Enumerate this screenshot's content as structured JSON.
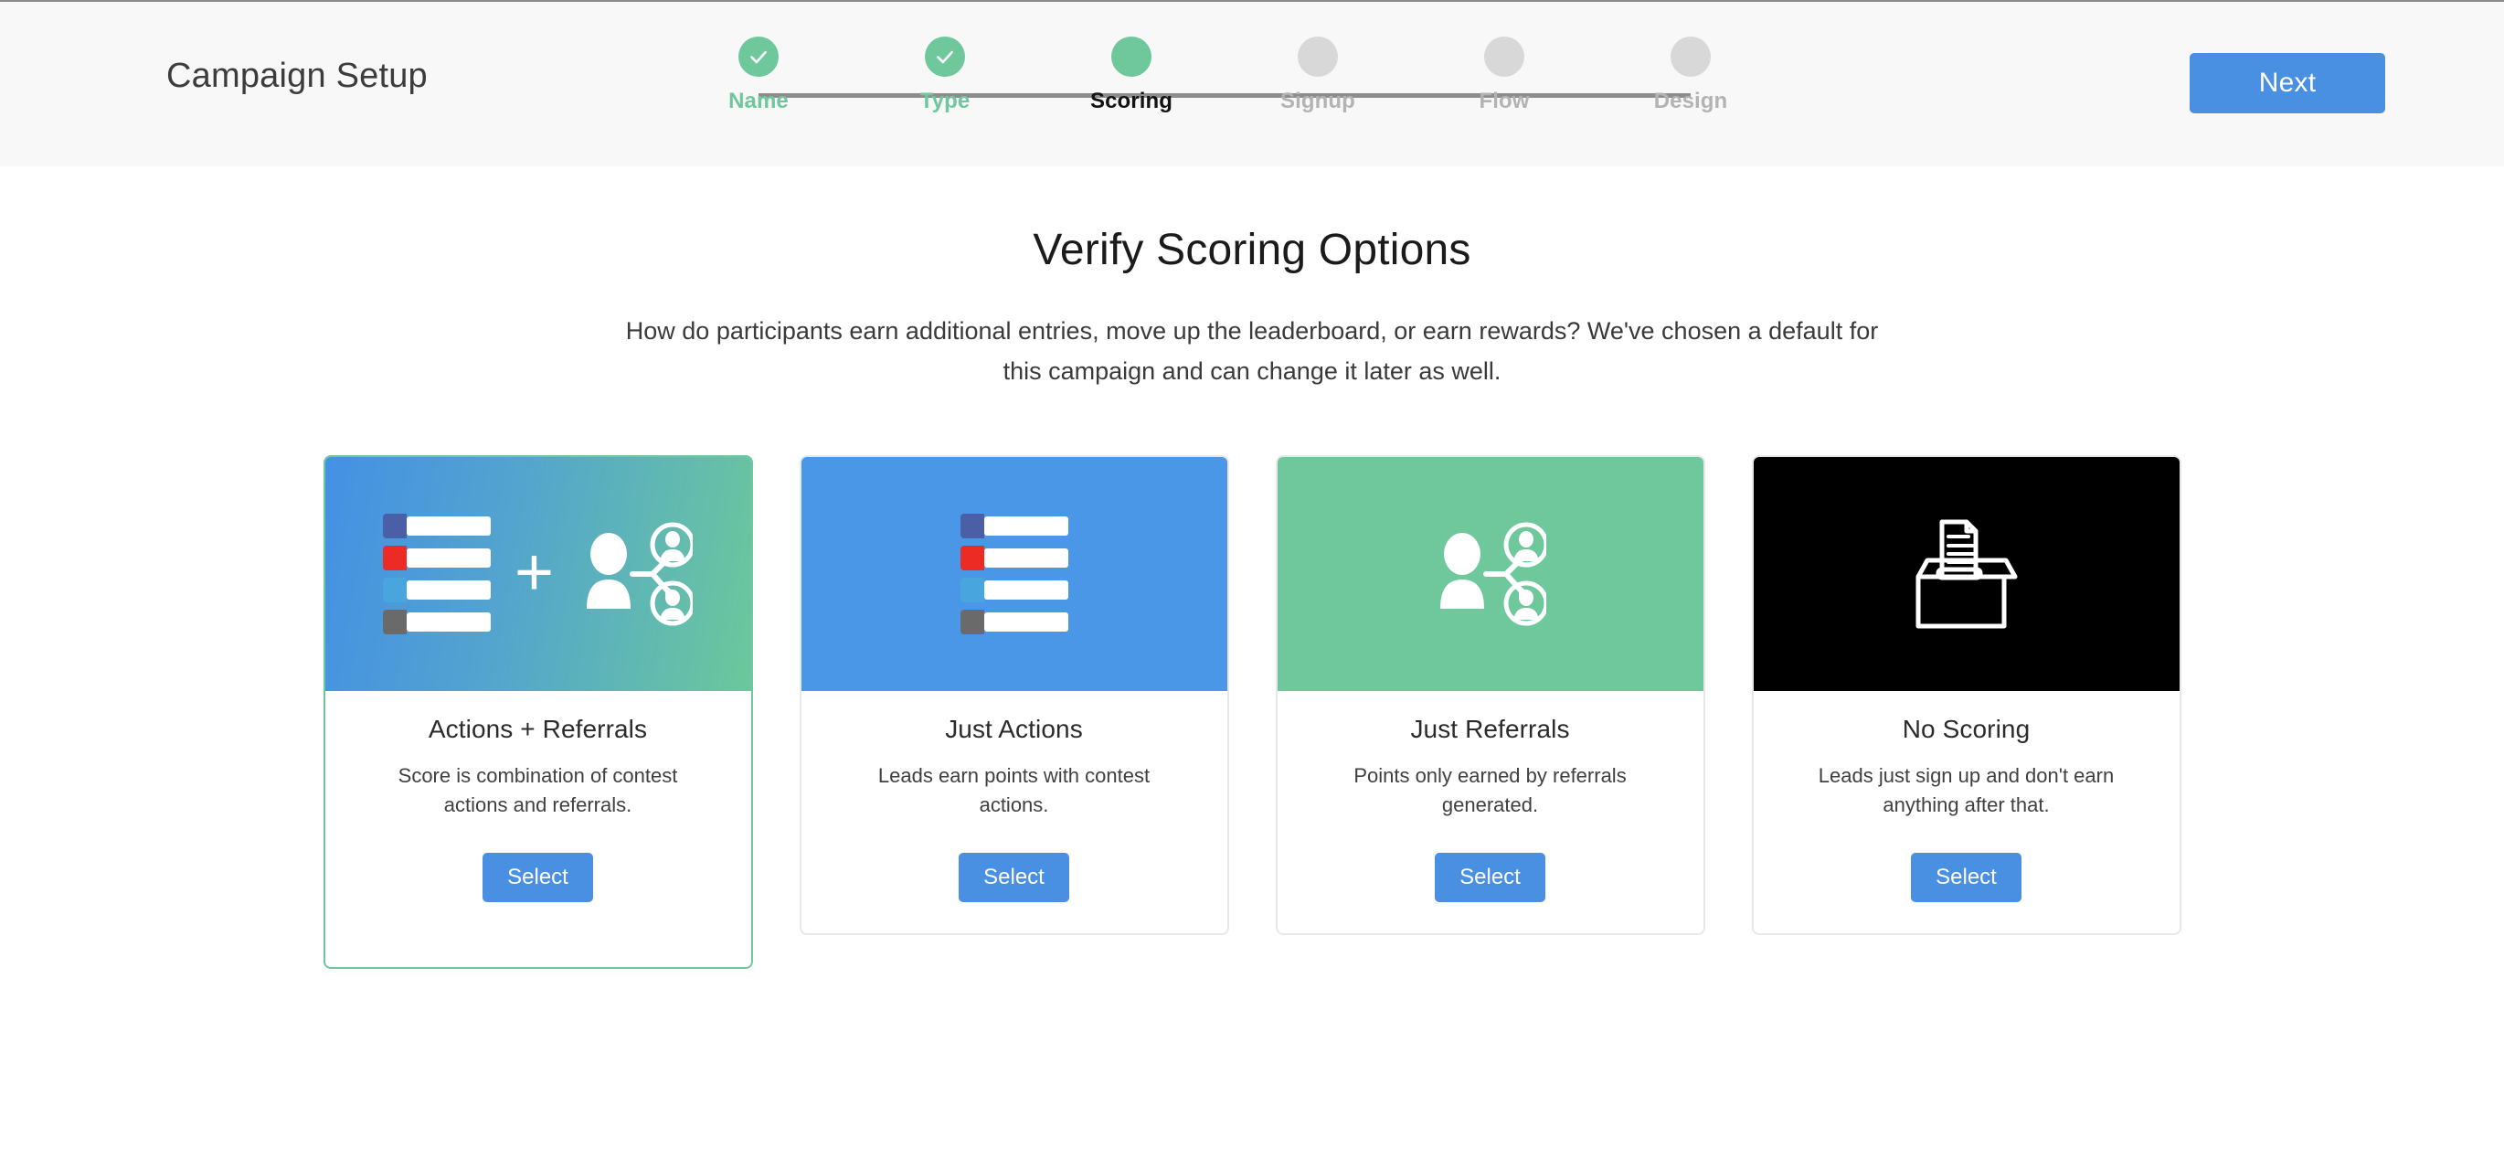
{
  "header": {
    "title": "Campaign Setup",
    "next_label": "Next",
    "next_color": "#4a90e2",
    "done_color": "#6ec89c",
    "pending_color": "#d8d8d8",
    "steps": [
      {
        "label": "Name",
        "state": "done"
      },
      {
        "label": "Type",
        "state": "done"
      },
      {
        "label": "Scoring",
        "state": "current"
      },
      {
        "label": "Signup",
        "state": "pending"
      },
      {
        "label": "Flow",
        "state": "pending"
      },
      {
        "label": "Design",
        "state": "pending"
      }
    ]
  },
  "main": {
    "title": "Verify Scoring Options",
    "subtitle": "How do participants earn additional entries, move up the leaderboard, or earn rewards? We've chosen a default for this campaign and can change it later as well.",
    "cards": [
      {
        "title": "Actions + Referrals",
        "description": "Score is combination of contest actions and referrals.",
        "select_label": "Select",
        "selected": true,
        "art": "list-plus-referral-illustration",
        "art_style": "blue-green-gradient",
        "list_tab_colors": [
          "#4a5fa5",
          "#ec2b24",
          "#49a5dd",
          "#6a6a6a"
        ]
      },
      {
        "title": "Just Actions",
        "description": "Leads earn points with contest actions.",
        "select_label": "Select",
        "selected": false,
        "art": "list-illustration",
        "art_style": "blue",
        "list_tab_colors": [
          "#4a5fa5",
          "#ec2b24",
          "#49a5dd",
          "#6a6a6a"
        ]
      },
      {
        "title": "Just Referrals",
        "description": "Points only earned by referrals generated.",
        "select_label": "Select",
        "selected": false,
        "art": "referral-illustration",
        "art_style": "green",
        "list_tab_colors": []
      },
      {
        "title": "No Scoring",
        "description": "Leads just sign up and don't earn anything after that.",
        "select_label": "Select",
        "selected": false,
        "art": "ballot-box-illustration",
        "art_style": "black",
        "list_tab_colors": []
      }
    ]
  }
}
